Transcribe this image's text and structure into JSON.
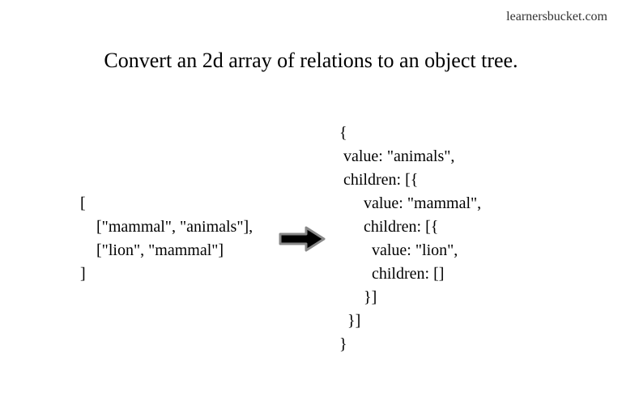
{
  "watermark": "learnersbucket.com",
  "title": "Convert an 2d array of relations to an object tree.",
  "input_code": "[\n    [\"mammal\", \"animals\"],\n    [\"lion\", \"mammal\"]\n]",
  "output_code": "{\n value: \"animals\",\n children: [{\n      value: \"mammal\",\n      children: [{\n        value: \"lion\",\n        children: []\n      }]\n  }]\n}",
  "arrow_icon": "arrow-right"
}
